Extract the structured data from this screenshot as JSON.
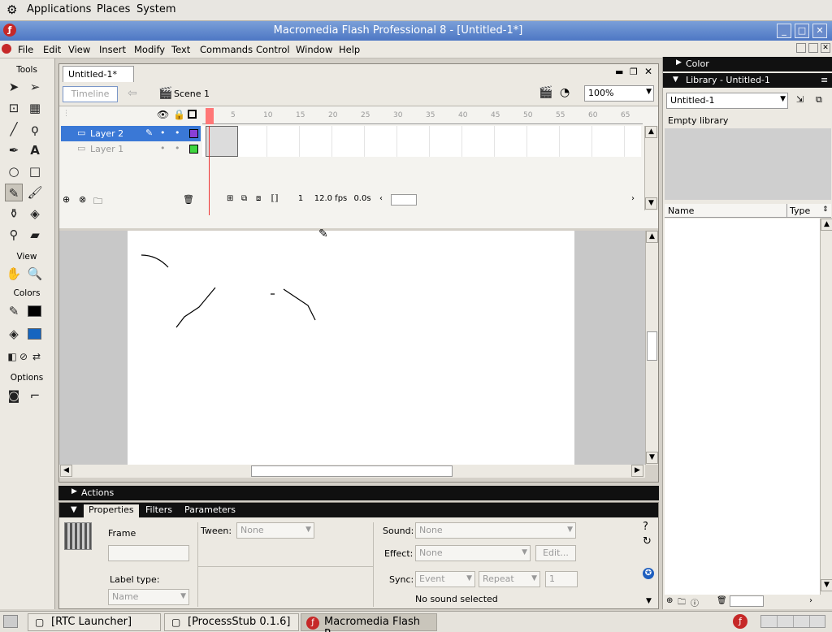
{
  "gnome": {
    "applications": "Applications",
    "places": "Places",
    "system": "System"
  },
  "window": {
    "title": "Macromedia Flash Professional 8 - [Untitled-1*]"
  },
  "menu": [
    "File",
    "Edit",
    "View",
    "Insert",
    "Modify",
    "Text",
    "Commands",
    "Control",
    "Window",
    "Help"
  ],
  "tools": {
    "header": "Tools",
    "view": "View",
    "colors": "Colors",
    "options": "Options",
    "stroke_color": "#000000",
    "fill_color": "#1565c0"
  },
  "doc": {
    "tab": "Untitled-1*",
    "timeline_button": "Timeline",
    "scene": "Scene 1",
    "zoom": "100%"
  },
  "timeline": {
    "ruler": [
      "5",
      "10",
      "15",
      "20",
      "25",
      "30",
      "35",
      "40",
      "45",
      "50",
      "55",
      "60",
      "65"
    ],
    "layers": [
      {
        "name": "Layer 2",
        "color": "#8a3fd6",
        "selected": true
      },
      {
        "name": "Layer 1",
        "color": "#3fd63f",
        "selected": false
      }
    ],
    "current_frame": "1",
    "fps": "12.0 fps",
    "elapsed": "0.0s"
  },
  "actions": {
    "label": "Actions"
  },
  "properties": {
    "tabs": [
      "Properties",
      "Filters",
      "Parameters"
    ],
    "frame_label": "Frame",
    "tween_label": "Tween:",
    "tween_value": "None",
    "label_type_label": "Label type:",
    "label_type_value": "Name",
    "sound_label": "Sound:",
    "sound_value": "None",
    "effect_label": "Effect:",
    "effect_value": "None",
    "edit_button": "Edit...",
    "sync_label": "Sync:",
    "sync_value": "Event",
    "repeat_value": "Repeat",
    "repeat_count": "1",
    "no_sound": "No sound selected"
  },
  "right": {
    "color_title": "Color",
    "library_title": "Library - Untitled-1",
    "library_select": "Untitled-1",
    "empty_text": "Empty library",
    "col_name": "Name",
    "col_type": "Type"
  },
  "taskbar": [
    {
      "label": "[RTC Launcher]",
      "active": false
    },
    {
      "label": "[ProcessStub 0.1.6]",
      "active": false
    },
    {
      "label": "Macromedia Flash P...",
      "active": true
    }
  ]
}
